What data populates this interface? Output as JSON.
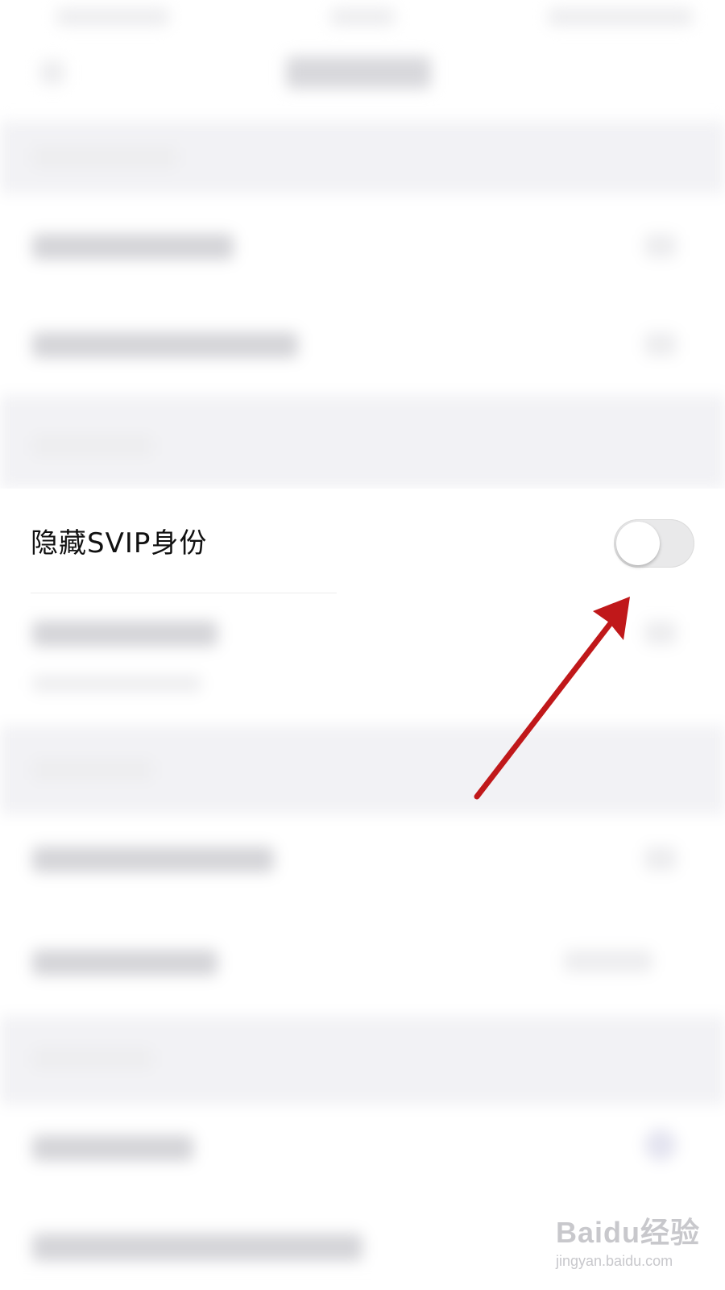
{
  "setting": {
    "label": "隐藏SVIP身份",
    "toggle_on": false
  },
  "watermark": {
    "logo": "Baidu经验",
    "domain": "jingyan.baidu.com"
  },
  "colors": {
    "arrow": "#c0181a",
    "section_bg": "#f2f2f5",
    "toggle_off": "#e9e9ea"
  }
}
